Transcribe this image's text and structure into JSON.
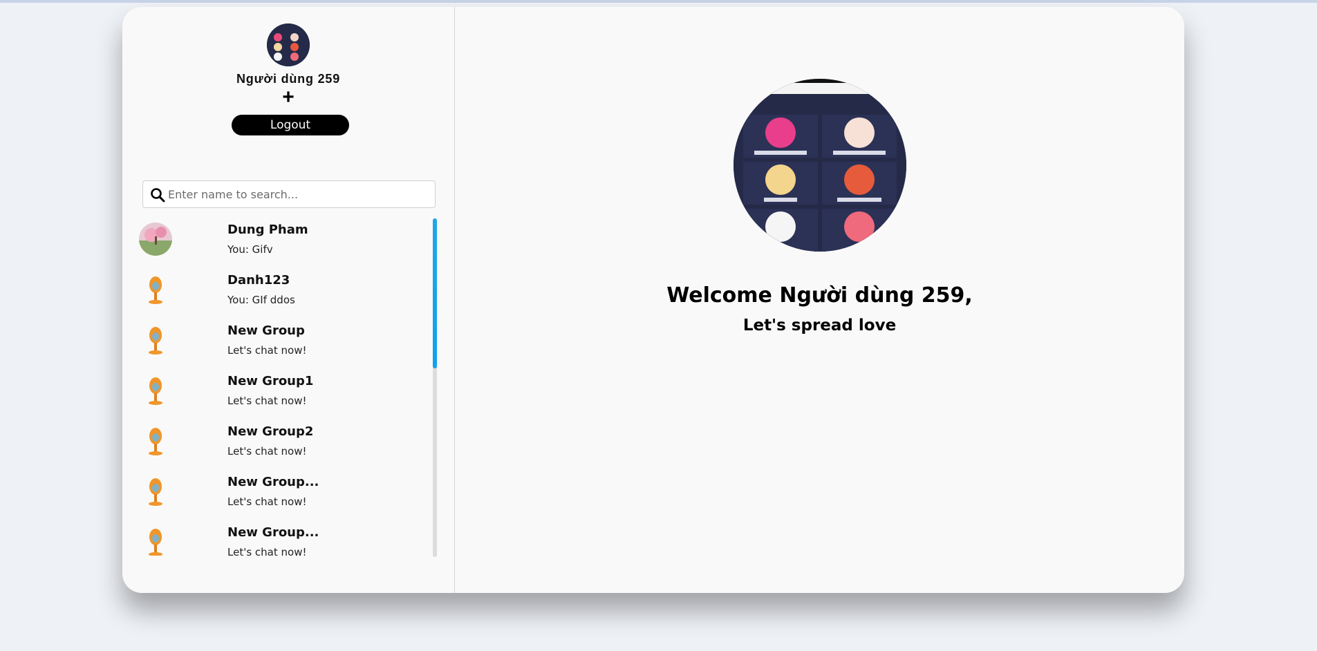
{
  "user": {
    "name": "Người dùng 259"
  },
  "header": {
    "add_symbol": "+",
    "logout_label": "Logout"
  },
  "search": {
    "placeholder": "Enter name to search..."
  },
  "conversations": [
    {
      "name": "Dung Pham",
      "last_message": "You: Gifv",
      "avatar": "landscape-photo"
    },
    {
      "name": "Danh123",
      "last_message": "You: GIf ddos",
      "avatar": "default-tree-avatar"
    },
    {
      "name": "New Group",
      "last_message": "Let's chat now!",
      "avatar": "default-tree-avatar"
    },
    {
      "name": "New Group1",
      "last_message": "Let's chat now!",
      "avatar": "default-tree-avatar"
    },
    {
      "name": "New Group2",
      "last_message": "Let's chat now!",
      "avatar": "default-tree-avatar"
    },
    {
      "name": "New Group...",
      "last_message": "Let's chat now!",
      "avatar": "default-tree-avatar"
    },
    {
      "name": "New Group...",
      "last_message": "Let's chat now!",
      "avatar": "default-tree-avatar"
    }
  ],
  "welcome": {
    "greeting": "Welcome Người dùng 259,",
    "tagline": "Let's spread love"
  },
  "colors": {
    "accent_scrollbar": "#0ea2ef",
    "logout_bg": "#000000",
    "card_bg": "#f9f9f9",
    "page_bg": "#eef1f6"
  }
}
